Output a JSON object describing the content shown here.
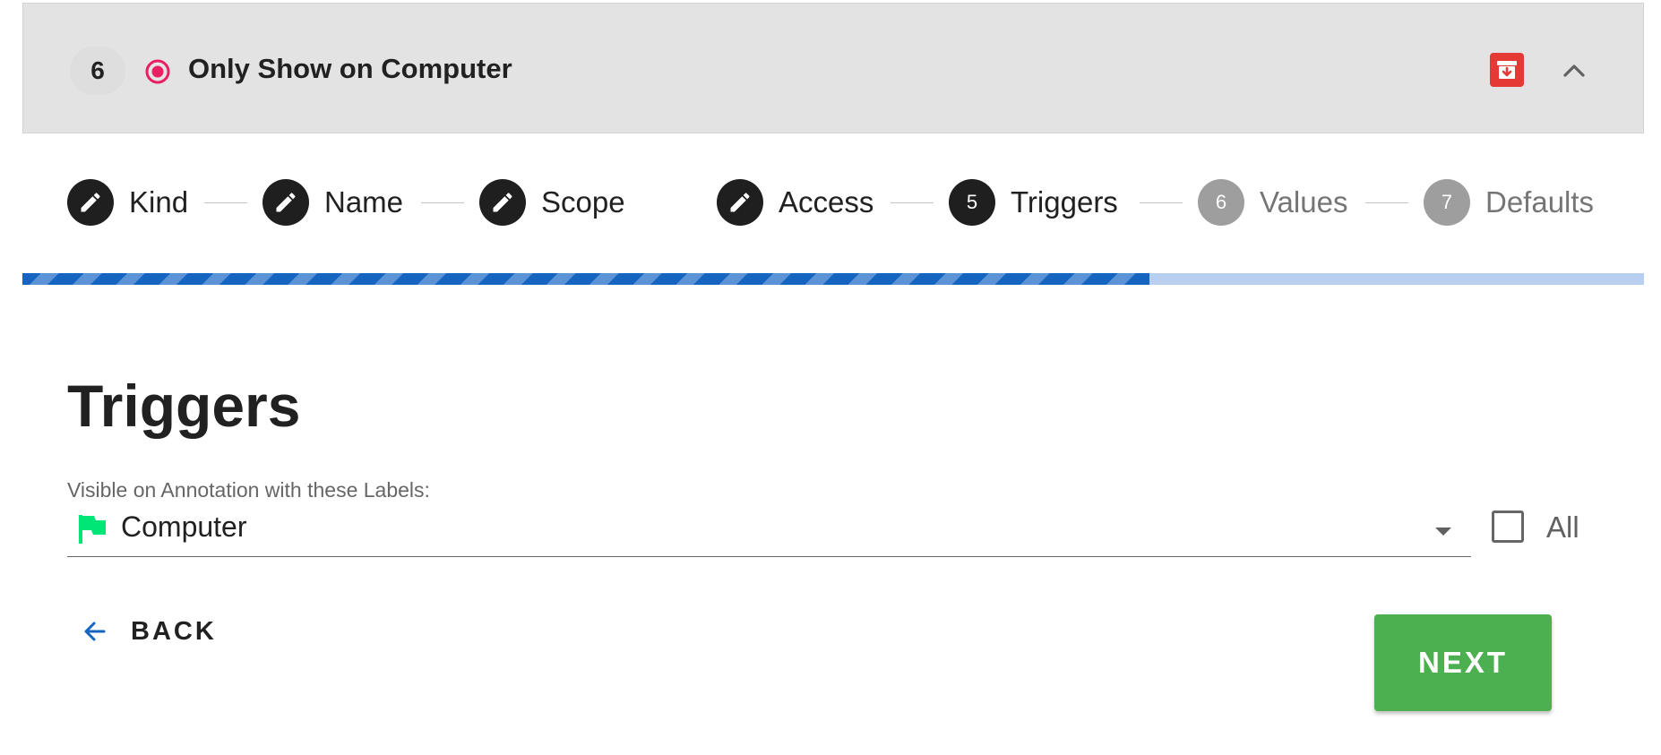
{
  "header": {
    "step_number": "6",
    "title": "Only Show on Computer",
    "radio_icon": "radio-checked-icon",
    "archive_icon": "archive-icon",
    "collapse_icon": "chevron-up-icon",
    "accent_color": "#e91e63",
    "archive_color": "#e53935"
  },
  "stepper": {
    "steps": [
      {
        "indicator": "",
        "label": "Kind",
        "state": "done",
        "icon": "pencil-icon"
      },
      {
        "indicator": "",
        "label": "Name",
        "state": "done",
        "icon": "pencil-icon"
      },
      {
        "indicator": "",
        "label": "Scope",
        "state": "done",
        "icon": "pencil-icon"
      },
      {
        "indicator": "",
        "label": "Access",
        "state": "done",
        "icon": "pencil-icon"
      },
      {
        "indicator": "5",
        "label": "Triggers",
        "state": "active"
      },
      {
        "indicator": "6",
        "label": "Values",
        "state": "todo"
      },
      {
        "indicator": "7",
        "label": "Defaults",
        "state": "todo"
      }
    ],
    "progress_fraction": 0.695,
    "progress_color": "#1565c0"
  },
  "main": {
    "title": "Triggers",
    "labels_field": {
      "label": "Visible on Annotation with these Labels:",
      "selected_label": "Computer",
      "selected_icon": "flag-icon",
      "selected_color": "#00e676",
      "dropdown_icon": "caret-down-icon"
    },
    "all_checkbox": {
      "label": "All",
      "checked": false
    },
    "back_button": {
      "label": "BACK",
      "icon": "arrow-left-icon",
      "icon_color": "#1565c0"
    },
    "next_button": {
      "label": "NEXT",
      "color": "#4caf50"
    }
  }
}
